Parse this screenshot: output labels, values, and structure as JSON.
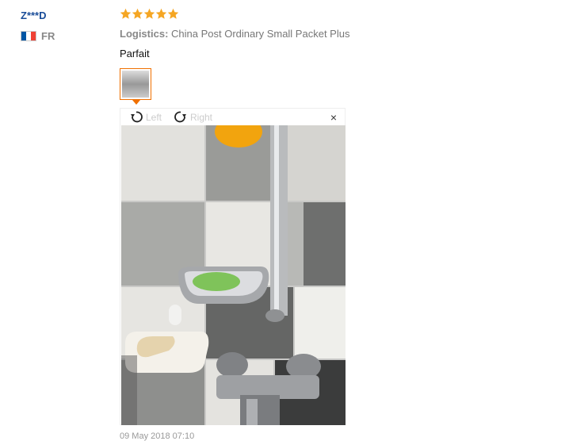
{
  "user": {
    "name": "Z***D",
    "country_code": "FR",
    "flag_colors": [
      "#0055a4",
      "#ffffff",
      "#ef4135"
    ]
  },
  "review": {
    "rating": 5,
    "star_color": "#f5a623",
    "logistics_label": "Logistics:",
    "logistics_value": "China Post Ordinary Small Packet Plus",
    "text": "Parfait",
    "date": "09 May 2018 07:10"
  },
  "viewer": {
    "rotate_left_label": "Left",
    "rotate_right_label": "Right",
    "close_label": "×",
    "icons": {
      "left": "rotate-left-icon",
      "right": "rotate-right-icon",
      "close": "close-icon"
    }
  }
}
